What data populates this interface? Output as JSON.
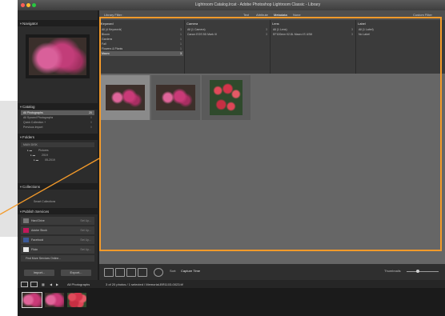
{
  "window": {
    "title": "Lightroom Catalog.lrcat - Adobe Photoshop Lightroom Classic - Library"
  },
  "left_panel": {
    "navigator_label": "Navigator",
    "catalog_label": "Catalog",
    "catalog_items": [
      {
        "label": "All Photographs",
        "count": "20"
      },
      {
        "label": "All Synced Photographs",
        "count": "0"
      },
      {
        "label": "Quick Collection +",
        "count": "0"
      },
      {
        "label": "Previous Import",
        "count": "0"
      }
    ],
    "folders_label": "Folders",
    "folder_volume": "MAIN DISK",
    "folder_items": [
      "Pictures",
      "2019",
      "05-2019"
    ],
    "collections_label": "Collections",
    "collections_item": "Smart Collections",
    "publish_label": "Publish Services",
    "services": [
      {
        "label": "Hard Drive",
        "status": "Set Up..."
      },
      {
        "label": "Adobe Stock",
        "status": "Set Up..."
      },
      {
        "label": "Facebook",
        "status": "Set Up..."
      },
      {
        "label": "Flickr",
        "status": "Set Up..."
      }
    ],
    "find_more_label": "Find More Services Online...",
    "import_label": "Import...",
    "export_label": "Export..."
  },
  "filter_bar": {
    "library_filter_label": "Library Filter :",
    "options": [
      "Text",
      "Attribute",
      "Metadata",
      "None"
    ],
    "active_option": "Metadata",
    "custom_label": "Custom Filter"
  },
  "metadata_browser": {
    "columns": [
      {
        "header": "Keyword",
        "rows": [
          {
            "label": "All (4 Keywords)",
            "count": "3"
          },
          {
            "label": "Bloom",
            "count": "1"
          },
          {
            "label": "Gardens",
            "count": "1"
          },
          {
            "label": "Fall",
            "count": "1"
          },
          {
            "label": "Flowers & Plants",
            "count": "1"
          },
          {
            "label": "Macro",
            "count": "3"
          }
        ]
      },
      {
        "header": "Camera",
        "rows": [
          {
            "label": "All (1 Camera)",
            "count": "3"
          },
          {
            "label": "Canon EOS 5D Mark III",
            "count": "3"
          }
        ]
      },
      {
        "header": "Lens",
        "rows": [
          {
            "label": "All (1 Lens)",
            "count": "3"
          },
          {
            "label": "EF100mm f/2.8L Macro IS USM",
            "count": "3"
          }
        ]
      },
      {
        "header": "Label",
        "rows": [
          {
            "label": "All (1 Label)",
            "count": "3"
          },
          {
            "label": "No Label",
            "count": "3"
          }
        ]
      }
    ]
  },
  "grid": {
    "thumbnails": [
      {
        "name": "pink-flower-1",
        "selected": true
      },
      {
        "name": "pink-flower-2",
        "selected": false
      },
      {
        "name": "red-flowers",
        "selected": false
      }
    ]
  },
  "toolbar": {
    "sort_label": "Sort:",
    "sort_value": "Capture Time",
    "thumbnails_label": "Thumbnails"
  },
  "filmstrip_bar": {
    "source": "All Photographs",
    "summary": "3 of 20 photos / 1 selected / Memorial-BR1103-0023.tif"
  },
  "colors": {
    "highlight": "#f39a2a"
  }
}
